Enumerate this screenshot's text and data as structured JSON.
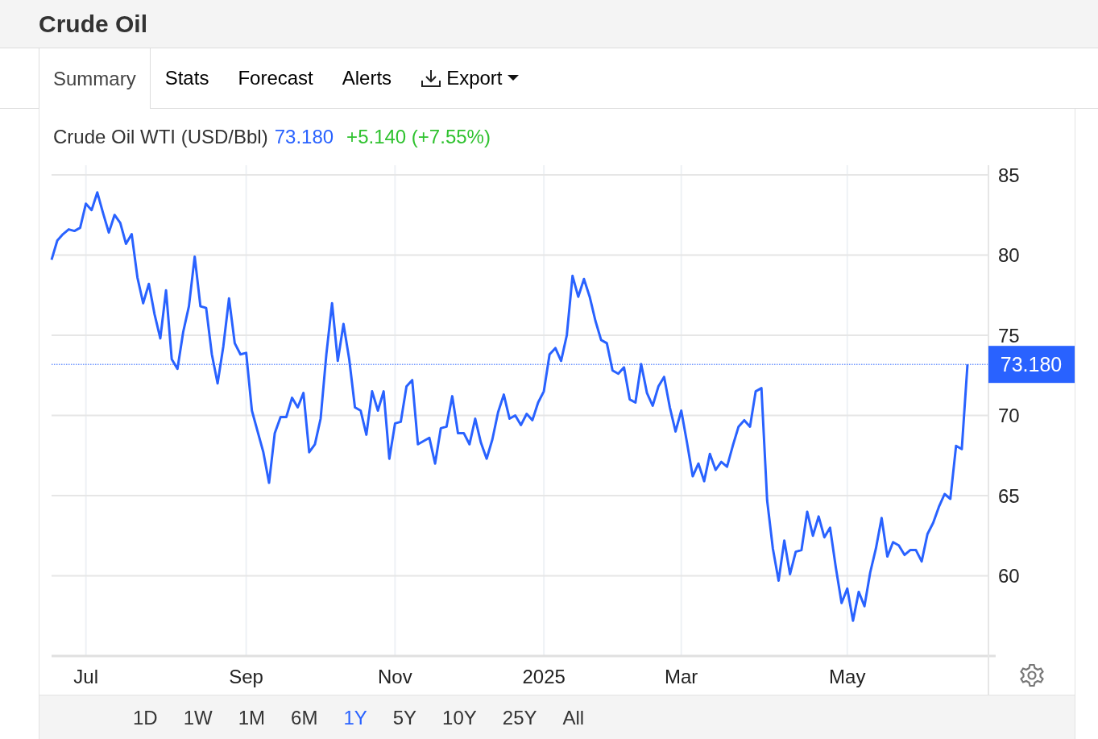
{
  "page": {
    "title": "Crude Oil"
  },
  "tabs": [
    {
      "label": "Summary",
      "selected": true,
      "kind": "tab"
    },
    {
      "label": "Stats",
      "selected": false,
      "kind": "tab"
    },
    {
      "label": "Forecast",
      "selected": false,
      "kind": "tab"
    },
    {
      "label": "Alerts",
      "selected": false,
      "kind": "tab"
    },
    {
      "label": "Export",
      "selected": false,
      "kind": "dropdown"
    }
  ],
  "quote": {
    "name": "Crude Oil WTI (USD/Bbl)",
    "price": "73.180",
    "change": "+5.140 (+7.55%)"
  },
  "chart_data": {
    "type": "line",
    "ylim": [
      55,
      85.6
    ],
    "categories": [
      null,
      null,
      null,
      null,
      null,
      null,
      "Jul",
      null,
      null,
      null,
      null,
      null,
      null,
      null,
      null,
      null,
      null,
      null,
      null,
      null,
      null,
      null,
      null,
      null,
      null,
      null,
      null,
      null,
      null,
      null,
      null,
      null,
      null,
      null,
      "Sep",
      null,
      null,
      null,
      null,
      null,
      null,
      null,
      null,
      null,
      null,
      null,
      null,
      null,
      null,
      null,
      null,
      null,
      null,
      null,
      null,
      null,
      null,
      null,
      null,
      null,
      "Nov",
      null,
      null,
      null,
      null,
      null,
      null,
      null,
      null,
      null,
      null,
      null,
      null,
      null,
      null,
      null,
      null,
      null,
      null,
      null,
      null,
      null,
      null,
      null,
      null,
      null,
      "2025",
      null,
      null,
      null,
      null,
      null,
      null,
      null,
      null,
      null,
      null,
      null,
      null,
      null,
      null,
      null,
      null,
      null,
      null,
      null,
      null,
      null,
      null,
      null,
      "Mar",
      null,
      null,
      null,
      null,
      null,
      null,
      null,
      null,
      null,
      null,
      null,
      null,
      null,
      null,
      null,
      null,
      null,
      null,
      null,
      null,
      null,
      null,
      null,
      null,
      null,
      null,
      null,
      null,
      "May",
      null,
      null,
      null,
      null,
      null,
      null,
      null,
      null,
      null,
      null,
      null,
      null,
      null,
      null,
      null,
      null,
      null,
      null,
      null,
      null,
      null
    ],
    "yticks": [
      60,
      65,
      70,
      75,
      80,
      85
    ],
    "annotations": [
      "73.180"
    ],
    "ref_lines": [
      {
        "axis": "y",
        "value": 73.18
      }
    ],
    "grid": true,
    "series": [
      {
        "color": "#2962ff",
        "values": [
          79.7,
          80.9,
          81.3,
          81.6,
          81.5,
          81.7,
          83.2,
          82.8,
          83.9,
          82.6,
          81.4,
          82.5,
          82.0,
          80.7,
          81.3,
          78.6,
          77.0,
          78.2,
          76.3,
          74.8,
          77.8,
          73.5,
          72.9,
          75.2,
          76.8,
          79.9,
          76.8,
          76.7,
          73.8,
          72.0,
          74.3,
          77.3,
          74.5,
          73.8,
          73.9,
          70.3,
          69.0,
          67.7,
          65.8,
          68.9,
          69.9,
          69.9,
          71.1,
          70.5,
          71.4,
          67.7,
          68.2,
          69.8,
          73.8,
          77.0,
          73.4,
          75.7,
          73.5,
          70.5,
          70.3,
          68.8,
          71.5,
          70.3,
          71.5,
          67.3,
          69.5,
          69.6,
          71.8,
          72.2,
          68.2,
          68.4,
          68.6,
          67.0,
          69.2,
          69.3,
          71.2,
          68.9,
          68.9,
          68.2,
          69.8,
          68.3,
          67.3,
          68.5,
          70.2,
          71.3,
          69.8,
          70.0,
          69.4,
          70.1,
          69.7,
          70.8,
          71.5,
          73.8,
          74.2,
          73.4,
          75.0,
          78.7,
          77.4,
          78.5,
          77.4,
          75.9,
          74.7,
          74.5,
          72.8,
          72.6,
          73.0,
          71.0,
          70.8,
          73.2,
          71.4,
          70.6,
          71.8,
          72.4,
          70.5,
          69.0,
          70.3,
          68.3,
          66.2,
          67.0,
          65.9,
          67.6,
          66.6,
          67.1,
          66.8,
          68.1,
          69.3,
          69.7,
          69.3,
          71.5,
          71.7,
          64.7,
          61.7,
          59.7,
          62.2,
          60.1,
          61.5,
          61.6,
          64.0,
          62.5,
          63.7,
          62.4,
          63.0,
          60.5,
          58.3,
          59.2,
          57.2,
          59.0,
          58.1,
          60.2,
          61.7,
          63.6,
          61.2,
          62.1,
          61.9,
          61.3,
          61.6,
          61.6,
          60.9,
          62.6,
          63.3,
          64.3,
          65.1,
          64.8,
          68.1,
          67.9,
          73.18
        ]
      }
    ]
  },
  "ranges": [
    {
      "label": "1D",
      "selected": false
    },
    {
      "label": "1W",
      "selected": false
    },
    {
      "label": "1M",
      "selected": false
    },
    {
      "label": "6M",
      "selected": false
    },
    {
      "label": "1Y",
      "selected": true
    },
    {
      "label": "5Y",
      "selected": false
    },
    {
      "label": "10Y",
      "selected": false
    },
    {
      "label": "25Y",
      "selected": false
    },
    {
      "label": "All",
      "selected": false
    }
  ]
}
